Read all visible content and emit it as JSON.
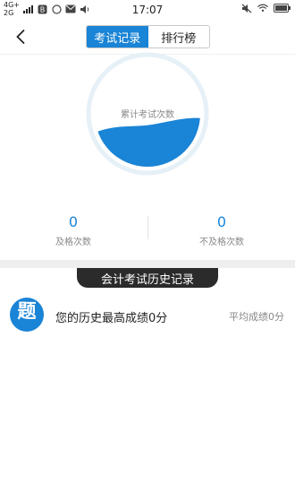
{
  "status_bar": {
    "network_top": "4G+",
    "network_bottom": "2G",
    "time": "17:07"
  },
  "nav": {
    "back_icon": "chevron-left-icon",
    "tabs": [
      {
        "label": "考试记录",
        "active": true
      },
      {
        "label": "排行榜",
        "active": false
      }
    ]
  },
  "stats": {
    "total_label": "累计考试次数",
    "total_value": "0",
    "pass_value": "0",
    "pass_label": "及格次数",
    "fail_value": "0",
    "fail_label": "不及格次数"
  },
  "history": {
    "section_title": "会计考试历史记录",
    "app_icon_glyph": "题",
    "best_score_text": "您的历史最高成绩0分",
    "avg_score_text": "平均成绩0分"
  },
  "colors": {
    "accent": "#1a84d6",
    "ring": "#e6f0f7",
    "wave": "#1a84d6",
    "section_tab_bg": "#2b2b2b"
  }
}
